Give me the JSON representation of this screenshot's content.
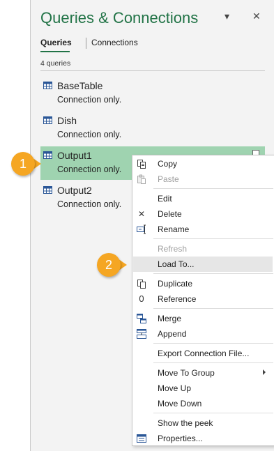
{
  "pane": {
    "title": "Queries & Connections",
    "dropdown_glyph": "▾",
    "close_glyph": "✕",
    "tabs": [
      {
        "label": "Queries"
      },
      {
        "label": "Connections"
      }
    ],
    "count": "4 queries",
    "queries": [
      {
        "name": "BaseTable",
        "sub": "Connection only."
      },
      {
        "name": "Dish",
        "sub": "Connection only."
      },
      {
        "name": "Output1",
        "sub": "Connection only."
      },
      {
        "name": "Output2",
        "sub": "Connection only."
      }
    ]
  },
  "menu": {
    "items": [
      {
        "label": "Copy",
        "icon": "copy-icon"
      },
      {
        "label": "Paste",
        "icon": "paste-icon"
      },
      {
        "label": "Edit"
      },
      {
        "label": "Delete",
        "icon": "delete-icon",
        "glyph": "✕"
      },
      {
        "label": "Rename",
        "icon": "rename-icon"
      },
      {
        "label": "Refresh"
      },
      {
        "label": "Load To..."
      },
      {
        "label": "Duplicate",
        "icon": "duplicate-icon"
      },
      {
        "label": "Reference",
        "icon": "reference-icon",
        "glyph": "0"
      },
      {
        "label": "Merge",
        "icon": "merge-icon"
      },
      {
        "label": "Append",
        "icon": "append-icon"
      },
      {
        "label": "Export Connection File..."
      },
      {
        "label": "Move To Group"
      },
      {
        "label": "Move Up"
      },
      {
        "label": "Move Down"
      },
      {
        "label": "Show the peek"
      },
      {
        "label": "Properties...",
        "icon": "properties-icon"
      }
    ]
  },
  "callouts": [
    "1",
    "2"
  ],
  "colors": {
    "accent": "#217346",
    "selected_row": "#9fd3b0",
    "callout": "#f5a623"
  }
}
